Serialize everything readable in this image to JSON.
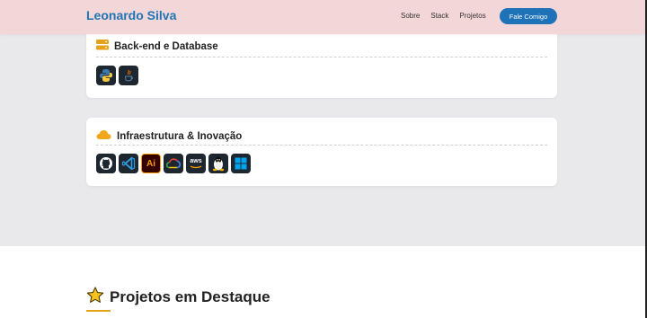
{
  "nav": {
    "brand": "Leonardo Silva",
    "links": [
      "Sobre",
      "Stack",
      "Projetos"
    ],
    "cta": "Fale Comigo"
  },
  "backend": {
    "title": "Back-end e Database",
    "icon": "server-icon",
    "techs": [
      "python-icon",
      "java-icon"
    ]
  },
  "infra": {
    "title": "Infraestrutura & Inovação",
    "icon": "cloud-icon",
    "techs": [
      "github-icon",
      "vscode-icon",
      "illustrator-icon",
      "google-cloud-icon",
      "aws-icon",
      "linux-icon",
      "windows-icon"
    ],
    "labels": {
      "ai": "Ai",
      "aws": "aws"
    }
  },
  "projects": {
    "title": "Projetos em Destaque",
    "icon": "star-icon"
  },
  "colors": {
    "nav_bg": "#f3d6d8",
    "brand": "#1f74b5",
    "accent": "#e3a21a"
  }
}
